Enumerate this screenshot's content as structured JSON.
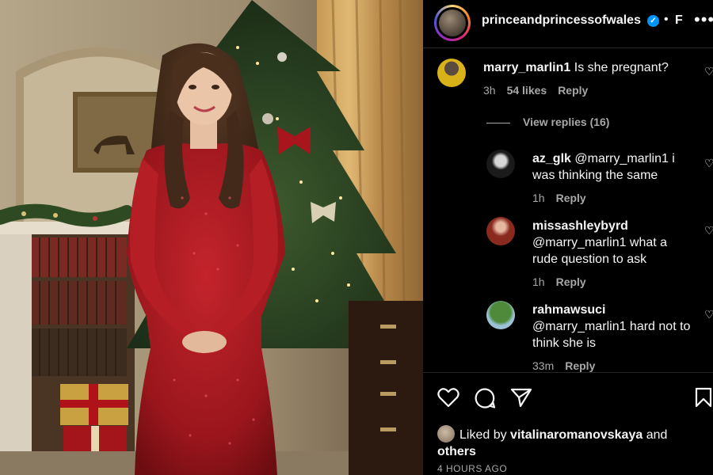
{
  "post": {
    "username": "princeandprincessofwales",
    "follow_label": "F",
    "more_label": "•••",
    "separator": "•"
  },
  "comments": [
    {
      "username": "marry_marlin1",
      "text": "Is she pregnant?",
      "time": "3h",
      "likes": "54 likes",
      "reply": "Reply"
    },
    {
      "username": "az_glk",
      "text": "@marry_marlin1 i was thinking the same",
      "time": "1h",
      "reply": "Reply"
    },
    {
      "username": "missashleybyrd",
      "text": "@marry_marlin1 what a rude question to ask",
      "time": "1h",
      "reply": "Reply"
    },
    {
      "username": "rahmawsuci",
      "text": "@marry_marlin1 hard not to think she is",
      "time": "33m",
      "reply": "Reply"
    }
  ],
  "view_replies": "View replies (16)",
  "likes": {
    "prefix": "Liked by",
    "user": "vitalinaromanovskaya",
    "and": "and",
    "others": "others"
  },
  "timestamp": "4 HOURS AGO",
  "icons": [
    "heart-icon",
    "comment-icon",
    "share-icon",
    "bookmark-icon",
    "verified-icon",
    "more-icon"
  ]
}
